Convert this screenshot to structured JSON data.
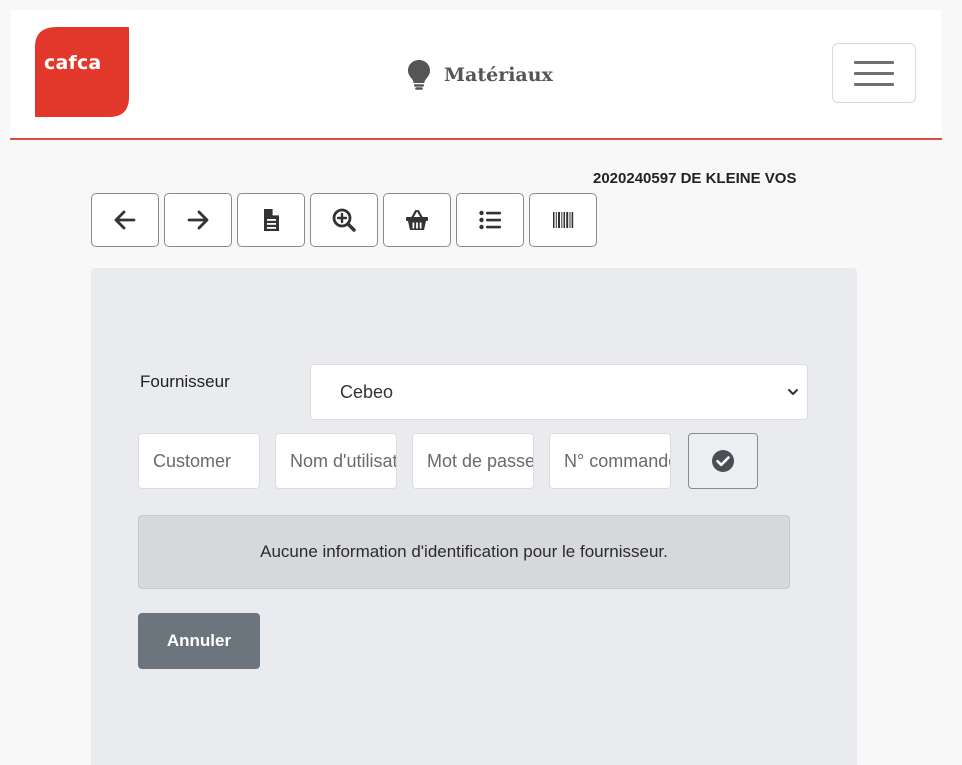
{
  "navbar": {
    "logo_text": "cafca",
    "title": "Matériaux",
    "icons": {
      "title_icon": "lightbulb-icon",
      "menu_icon": "hamburger-menu-icon"
    },
    "accent_color": "#e04a3f"
  },
  "record": {
    "label": "2020240597 DE KLEINE VOS"
  },
  "toolbar": {
    "buttons": [
      {
        "icon": "arrow-left-icon"
      },
      {
        "icon": "arrow-right-icon"
      },
      {
        "icon": "document-icon"
      },
      {
        "icon": "zoom-in-icon"
      },
      {
        "icon": "basket-icon"
      },
      {
        "icon": "list-icon"
      },
      {
        "icon": "barcode-icon"
      }
    ]
  },
  "form": {
    "supplier_label": "Fournisseur",
    "supplier_value": "Cebeo",
    "inputs": [
      {
        "placeholder": "Customer",
        "value": ""
      },
      {
        "placeholder": "Nom d'utilisateur",
        "value": ""
      },
      {
        "placeholder": "Mot de passe",
        "value": ""
      },
      {
        "placeholder": "N° commande",
        "value": ""
      }
    ],
    "confirm_icon": "check-circle-icon",
    "alert_text": "Aucune information d'identification pour le fournisseur.",
    "cancel_label": "Annuler"
  }
}
